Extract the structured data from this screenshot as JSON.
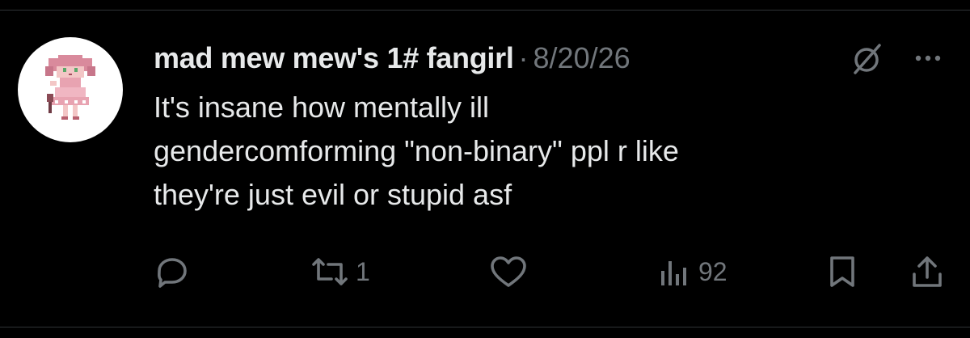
{
  "tweet": {
    "display_name": "mad mew mew's 1# fangirl",
    "separator": "·",
    "date": "8/20/26",
    "text_lines": [
      "It's insane how mentally ill",
      "gendercomforming \"non-binary\" ppl r like",
      "they're just evil or stupid asf"
    ]
  },
  "actions": {
    "reply_count": "",
    "repost_count": "1",
    "like_count": "",
    "views_count": "92"
  },
  "icons": {
    "header": [
      "no-symbol-icon",
      "more-options-icon"
    ],
    "actions": [
      "reply-icon",
      "repost-icon",
      "like-icon",
      "views-icon",
      "bookmark-icon",
      "share-icon"
    ]
  },
  "colors": {
    "background": "#000000",
    "text_primary": "#e7e9ea",
    "text_secondary": "#71767b",
    "divider": "#2f3336"
  }
}
